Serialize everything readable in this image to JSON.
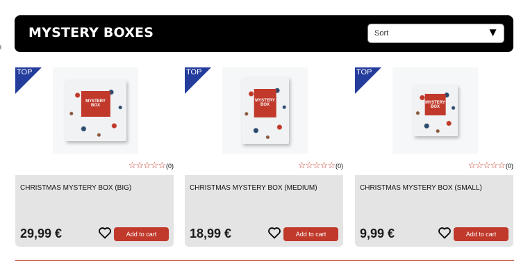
{
  "header": {
    "title": "MYSTERY BOXES",
    "sort": {
      "label": "Sort",
      "arrow": "▼"
    }
  },
  "products": [
    {
      "badge": "TOP",
      "image_label": "MYSTERY BOX",
      "name": "CHRISTMAS MYSTERY BOX (BIG)",
      "rating": {
        "stars": "☆☆☆☆☆",
        "filled": 0,
        "max": 5,
        "count": "(0)"
      },
      "price": "29,99 €",
      "add_to_cart": "Add to cart",
      "wishlist_icon": "heart-icon"
    },
    {
      "badge": "TOP",
      "image_label": "MYSTERY BOX",
      "name": "CHRISTMAS MYSTERY BOX (MEDIUM)",
      "rating": {
        "stars": "☆☆☆☆☆",
        "filled": 0,
        "max": 5,
        "count": "(0)"
      },
      "price": "18,99 €",
      "add_to_cart": "Add to cart",
      "wishlist_icon": "heart-icon"
    },
    {
      "badge": "TOP",
      "image_label": "MYSTERY BOX",
      "name": "CHRISTMAS MYSTERY BOX (SMALL)",
      "rating": {
        "stars": "☆☆☆☆☆",
        "filled": 0,
        "max": 5,
        "count": "(0)"
      },
      "price": "9,99 €",
      "add_to_cart": "Add to cart",
      "wishlist_icon": "heart-icon"
    }
  ],
  "colors": {
    "header_bg": "#000000",
    "accent": "#c0392b",
    "badge": "#243c9c",
    "card_bg": "#e4e4e4"
  }
}
